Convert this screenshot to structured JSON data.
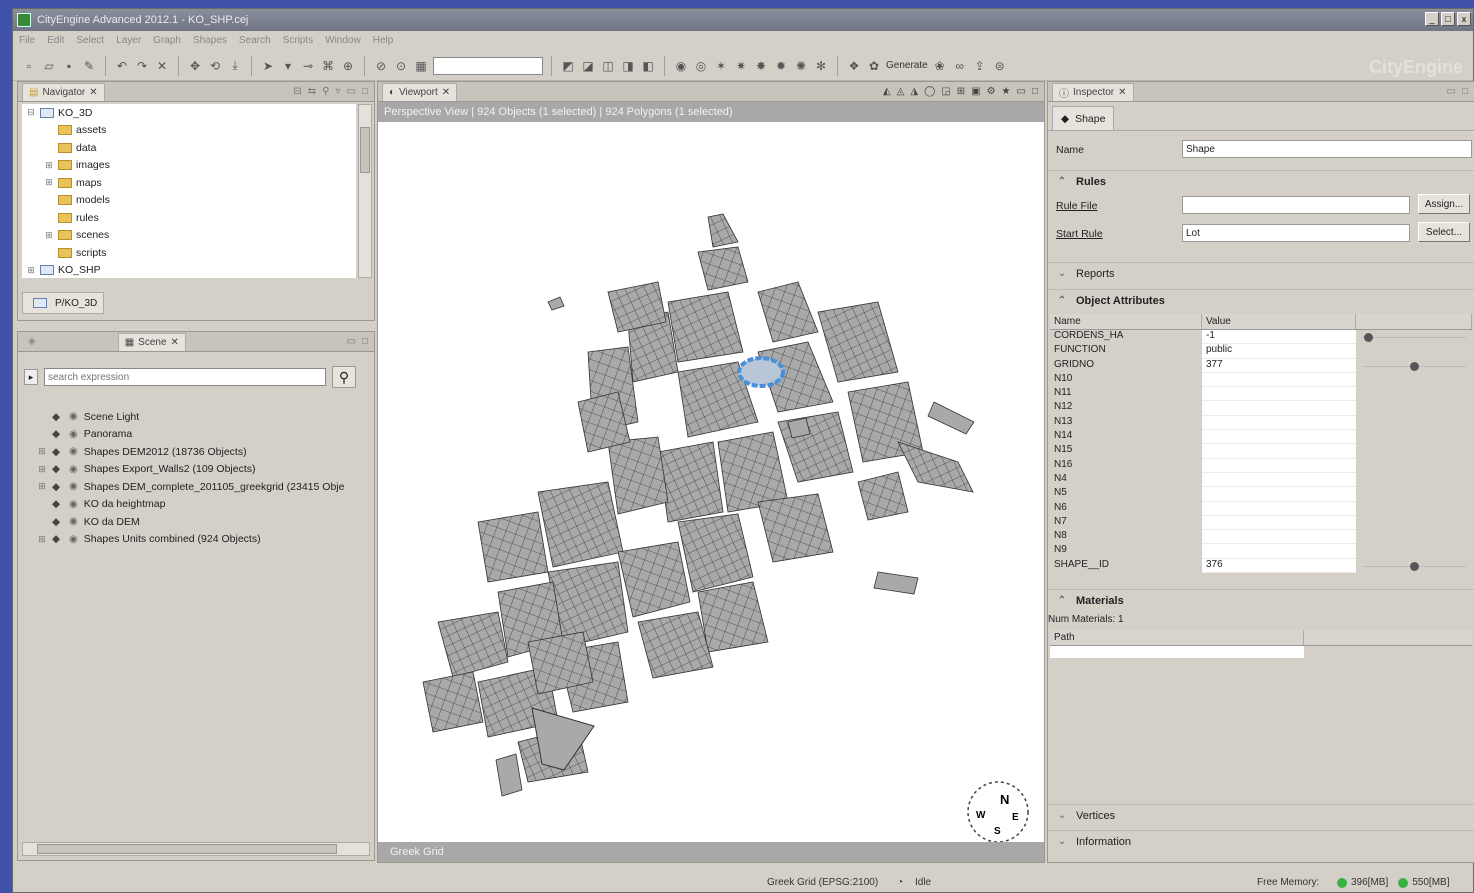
{
  "window": {
    "title": "CityEngine Advanced 2012.1 - KO_SHP.cej",
    "controls": [
      "_",
      "□",
      "x"
    ]
  },
  "menu": [
    "File",
    "Edit",
    "Select",
    "Layer",
    "Graph",
    "Shapes",
    "Search",
    "Scripts",
    "Window",
    "Help"
  ],
  "toolbar": {
    "generate_label": "Generate",
    "logo_text": "CityEngine"
  },
  "navigator": {
    "tab_label": "Navigator",
    "items": [
      {
        "label": "KO_3D",
        "level": 0,
        "expander": "⊟",
        "kind": "project"
      },
      {
        "label": "assets",
        "level": 1,
        "expander": "",
        "kind": "folder"
      },
      {
        "label": "data",
        "level": 1,
        "expander": "",
        "kind": "folder"
      },
      {
        "label": "images",
        "level": 1,
        "expander": "⊞",
        "kind": "folder"
      },
      {
        "label": "maps",
        "level": 1,
        "expander": "⊞",
        "kind": "folder"
      },
      {
        "label": "models",
        "level": 1,
        "expander": "",
        "kind": "folder"
      },
      {
        "label": "rules",
        "level": 1,
        "expander": "",
        "kind": "folder"
      },
      {
        "label": "scenes",
        "level": 1,
        "expander": "⊞",
        "kind": "folder"
      },
      {
        "label": "scripts",
        "level": 1,
        "expander": "",
        "kind": "folder"
      },
      {
        "label": "KO_SHP",
        "level": 0,
        "expander": "⊞",
        "kind": "project"
      }
    ],
    "breadcrumb": "P/KO_3D"
  },
  "scene_panel": {
    "tab_label": "Scene",
    "search_placeholder": "search expression",
    "items": [
      {
        "label": "Scene Light",
        "expander": ""
      },
      {
        "label": "Panorama",
        "expander": ""
      },
      {
        "label": "Shapes DEM2012 (18736 Objects)",
        "expander": "⊞"
      },
      {
        "label": "Shapes Export_Walls2 (109 Objects)",
        "expander": "⊞"
      },
      {
        "label": "Shapes DEM_complete_201105_greekgrid (23415 Obje",
        "expander": "⊞"
      },
      {
        "label": "KO da heightmap",
        "expander": ""
      },
      {
        "label": "KO da DEM",
        "expander": ""
      },
      {
        "label": "Shapes Units combined (924 Objects)",
        "expander": "⊞"
      }
    ]
  },
  "viewport": {
    "tab_label": "Viewport",
    "header": "Perspective View  |  924 Objects  (1 selected)  |  924 Polygons  (1 selected)",
    "footer": "Greek Grid",
    "compass_n": "N",
    "compass_e": "E",
    "compass_s": "S",
    "compass_w": "W",
    "shape_fill": "#a8a8a8",
    "selected_fill": "#4a90d9"
  },
  "inspector": {
    "tab_label": "Inspector",
    "shape_tab": "Shape",
    "name_label": "Name",
    "name_value": "Shape",
    "rules_section": "Rules",
    "rule_file_label": "Rule File",
    "rule_file_value": "",
    "assign_button": "Assign...",
    "start_rule_label": "Start Rule",
    "start_rule_value": "Lot",
    "select_button": "Select...",
    "reports_section": "Reports",
    "object_attributes_section": "Object Attributes",
    "attr_col_name": "Name",
    "attr_col_value": "Value",
    "attributes": [
      {
        "name": "CORDENS_HA",
        "value": "-1",
        "knob": 0.02
      },
      {
        "name": "FUNCTION",
        "value": "public",
        "knob": null
      },
      {
        "name": "GRIDNO",
        "value": "377",
        "knob": 0.48
      },
      {
        "name": "N10",
        "value": "",
        "knob": null
      },
      {
        "name": "N11",
        "value": "",
        "knob": null
      },
      {
        "name": "N12",
        "value": "",
        "knob": null
      },
      {
        "name": "N13",
        "value": "",
        "knob": null
      },
      {
        "name": "N14",
        "value": "",
        "knob": null
      },
      {
        "name": "N15",
        "value": "",
        "knob": null
      },
      {
        "name": "N16",
        "value": "",
        "knob": null
      },
      {
        "name": "N4",
        "value": "",
        "knob": null
      },
      {
        "name": "N5",
        "value": "",
        "knob": null
      },
      {
        "name": "N6",
        "value": "",
        "knob": null
      },
      {
        "name": "N7",
        "value": "",
        "knob": null
      },
      {
        "name": "N8",
        "value": "",
        "knob": null
      },
      {
        "name": "N9",
        "value": "",
        "knob": null
      },
      {
        "name": "SHAPE__ID",
        "value": "376",
        "knob": 0.48
      }
    ],
    "materials_section": "Materials",
    "num_materials": "Num Materials:  1",
    "path_col": "Path",
    "vertices_section": "Vertices",
    "information_section": "Information"
  },
  "status": {
    "coord_system": "Greek Grid (EPSG:2100)",
    "state": "Idle",
    "free_memory_label": "Free Memory:",
    "mem1": "396[MB]",
    "mem2": "550[MB]"
  }
}
